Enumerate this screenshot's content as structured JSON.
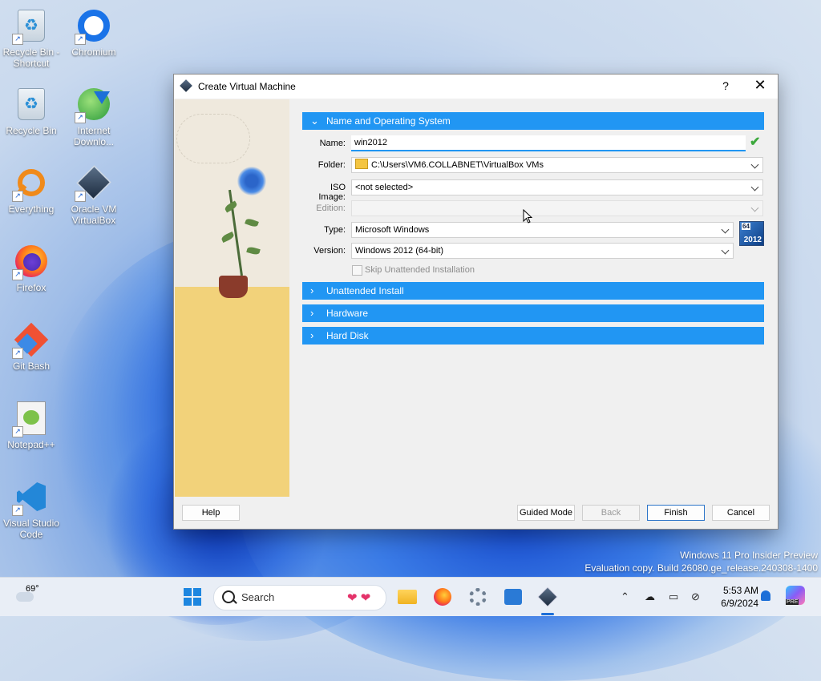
{
  "desktop": {
    "icons": [
      {
        "label": "Recycle Bin - Shortcut",
        "icon": "recycle-bin-icon"
      },
      {
        "label": "Chromium",
        "icon": "chromium-icon"
      },
      {
        "label": "Recycle Bin",
        "icon": "recycle-bin-icon"
      },
      {
        "label": "Internet Downlo...",
        "icon": "internet-download-manager-icon"
      },
      {
        "label": "Everything",
        "icon": "everything-search-icon"
      },
      {
        "label": "Oracle VM VirtualBox",
        "icon": "virtualbox-icon"
      },
      {
        "label": "Firefox",
        "icon": "firefox-icon"
      },
      {
        "label": "Git Bash",
        "icon": "git-bash-icon"
      },
      {
        "label": "Notepad++",
        "icon": "notepadpp-icon"
      },
      {
        "label": "Visual Studio Code",
        "icon": "vscode-icon"
      }
    ],
    "watermark": {
      "line1": "Windows 11 Pro Insider Preview",
      "line2": "Evaluation copy. Build 26080.ge_release.240308-1400"
    }
  },
  "dialog": {
    "title": "Create Virtual Machine",
    "help_glyph": "?",
    "close_glyph": "✕",
    "sections": {
      "name_os": "Name and Operating System",
      "unattended": "Unattended Install",
      "hardware": "Hardware",
      "hard_disk": "Hard Disk"
    },
    "form": {
      "name_label": "Name:",
      "name_value": "win2012",
      "folder_label": "Folder:",
      "folder_value": "C:\\Users\\VM6.COLLABNET\\VirtualBox VMs",
      "iso_label": "ISO Image:",
      "iso_value": "<not selected>",
      "edition_label": "Edition:",
      "edition_value": "",
      "type_label": "Type:",
      "type_value": "Microsoft Windows",
      "version_label": "Version:",
      "version_value": "Windows 2012 (64-bit)",
      "skip_unattended": "Skip Unattended Installation",
      "os_badge_bits": "64",
      "os_badge_year": "2012"
    },
    "buttons": {
      "help": "Help",
      "guided": "Guided Mode",
      "back": "Back",
      "finish": "Finish",
      "cancel": "Cancel"
    },
    "colors": {
      "section": "#2196f3",
      "check": "#3da93d"
    }
  },
  "taskbar": {
    "weather_temp": "69°",
    "search_placeholder": "Search",
    "time": "5:53 AM",
    "date": "6/9/2024",
    "copilot_badge": "PRE"
  }
}
